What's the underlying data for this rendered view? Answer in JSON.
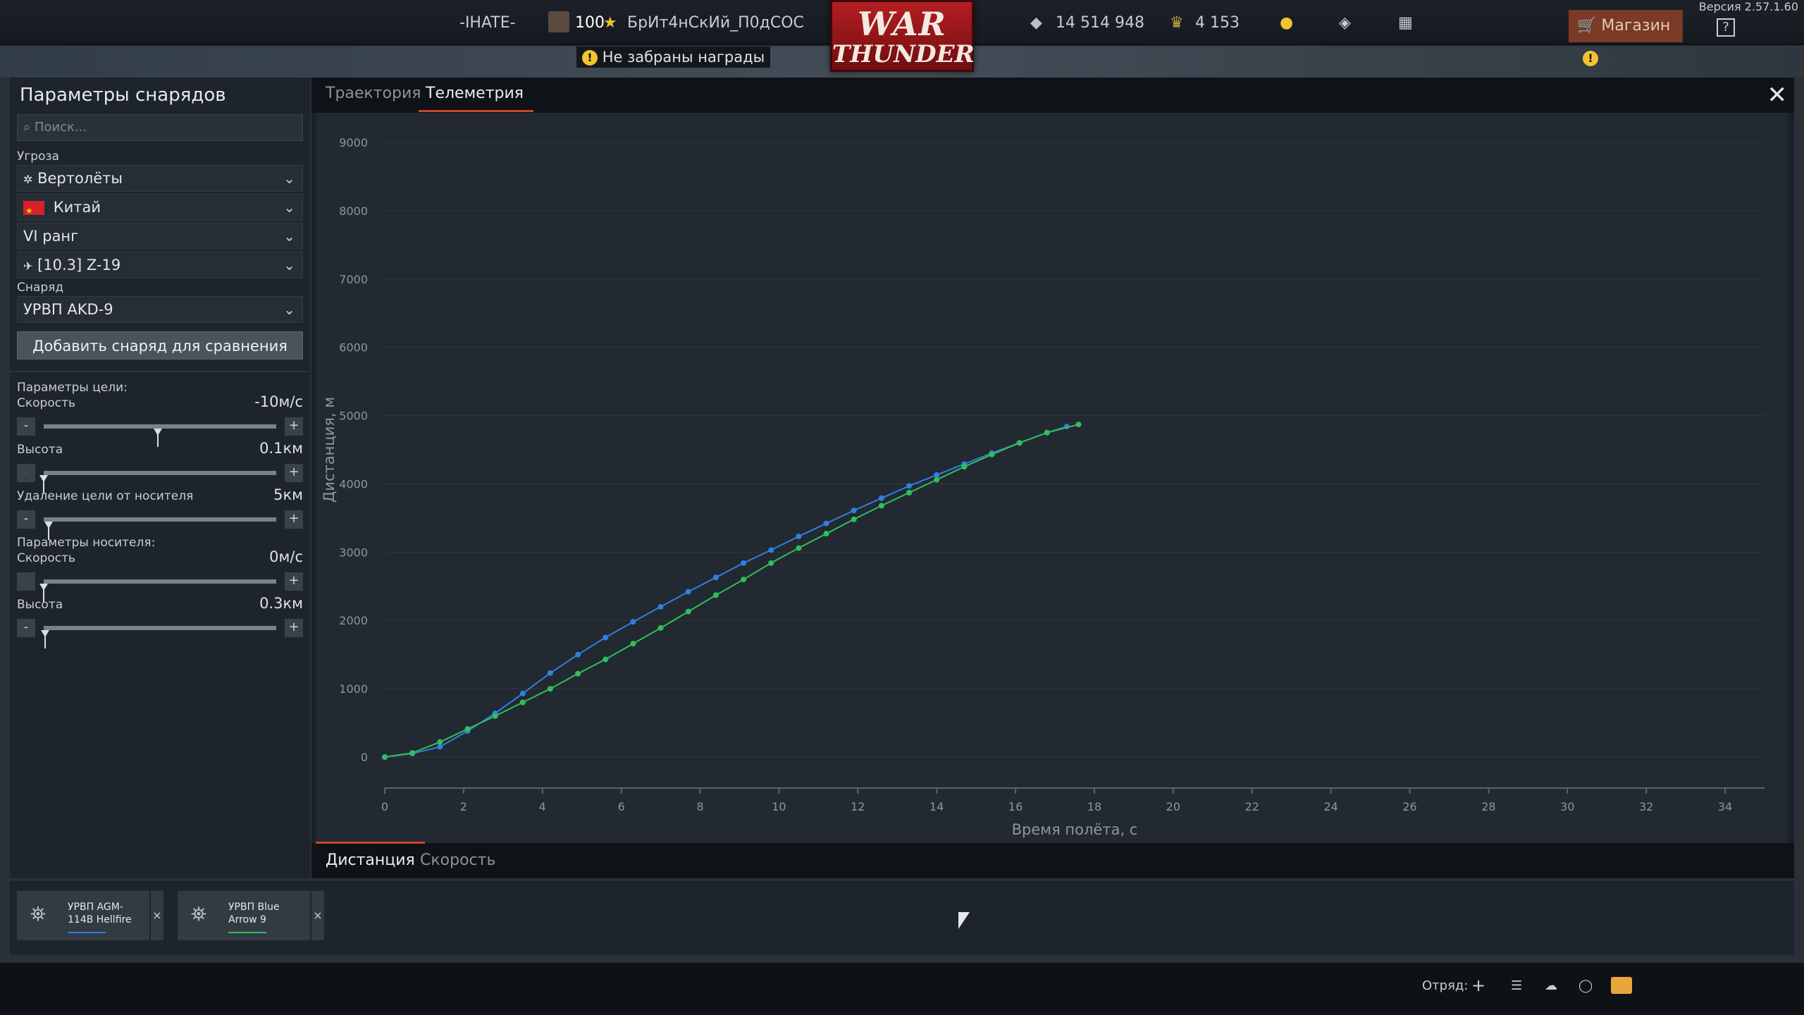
{
  "topbar": {
    "squad_tag": "-IHATE-",
    "level": "100",
    "nickname": "БрИт4нСкИй_П0дСОС",
    "rewards_notice": "Не забраны награды",
    "logo_line1": "WAR",
    "logo_line2": "THUNDER",
    "silver_lions": "14 514 948",
    "golden_eagles": "4 153",
    "shop_label": "Магазин",
    "help_label": "?",
    "version": "Версия 2.57.1.60",
    "icons": [
      "lion-icon",
      "eagle-icon",
      "bulb-icon",
      "diamond-icon",
      "coupon-icon"
    ]
  },
  "left_panel": {
    "title": "Параметры снарядов",
    "search_placeholder": "Поиск...",
    "threat_label": "Угроза",
    "threat_type": "Вертолёты",
    "country": "Китай",
    "rank": "VI ранг",
    "vehicle": "[10.3] Z-19",
    "shell_label": "Снаряд",
    "shell": "УРВП AKD-9",
    "compare_button": "Добавить снаряд для сравнения",
    "target_params_label": "Параметры цели:",
    "target_speed_label": "Скорость",
    "target_speed_value": "-10м/с",
    "target_height_label": "Высота",
    "target_height_value": "0.1км",
    "target_distance_label": "Удаление цели от носителя",
    "target_distance_value": "5км",
    "carrier_params_label": "Параметры носителя:",
    "carrier_speed_label": "Скорость",
    "carrier_speed_value": "0м/с",
    "carrier_height_label": "Высота",
    "carrier_height_value": "0.3км",
    "minus": "-",
    "plus": "+",
    "slider_levels": {
      "target_speed": 0.49,
      "target_height": 0.0,
      "target_distance": 0.02,
      "carrier_speed": 0.0,
      "carrier_height": 0.005
    }
  },
  "main": {
    "tabs": [
      "Траектория",
      "Телеметрия"
    ],
    "active_tab": "Телеметрия",
    "bottom_tabs": [
      "Дистанция",
      "Скорость"
    ],
    "active_bottom_tab": "Дистанция"
  },
  "chart_data": {
    "type": "line",
    "xlabel": "Время полёта, с",
    "ylabel": "Дистанция, м",
    "xlim": [
      0,
      35
    ],
    "ylim": [
      0,
      9000
    ],
    "x_ticks": [
      0,
      2,
      4,
      6,
      8,
      10,
      12,
      14,
      16,
      18,
      20,
      22,
      24,
      26,
      28,
      30,
      32,
      34
    ],
    "y_ticks": [
      0,
      1000,
      2000,
      3000,
      4000,
      5000,
      6000,
      7000,
      8000,
      9000
    ],
    "grid": true,
    "series": [
      {
        "name": "УРВП AGM-114B Hellfire",
        "color": "#2f7fe0",
        "points": [
          [
            0,
            0
          ],
          [
            0.7,
            50
          ],
          [
            1.4,
            150
          ],
          [
            2.1,
            380
          ],
          [
            2.8,
            640
          ],
          [
            3.5,
            930
          ],
          [
            4.2,
            1230
          ],
          [
            4.9,
            1500
          ],
          [
            5.6,
            1750
          ],
          [
            6.3,
            1980
          ],
          [
            7.0,
            2200
          ],
          [
            7.7,
            2420
          ],
          [
            8.4,
            2630
          ],
          [
            9.1,
            2840
          ],
          [
            9.8,
            3030
          ],
          [
            10.5,
            3230
          ],
          [
            11.2,
            3420
          ],
          [
            11.9,
            3610
          ],
          [
            12.6,
            3790
          ],
          [
            13.3,
            3970
          ],
          [
            14.0,
            4130
          ],
          [
            14.7,
            4290
          ],
          [
            15.4,
            4450
          ],
          [
            16.1,
            4600
          ],
          [
            16.8,
            4750
          ],
          [
            17.3,
            4840
          ]
        ]
      },
      {
        "name": "УРВП Blue Arrow 9",
        "color": "#2fbf5a",
        "points": [
          [
            0,
            0
          ],
          [
            0.7,
            60
          ],
          [
            1.4,
            220
          ],
          [
            2.1,
            410
          ],
          [
            2.8,
            600
          ],
          [
            3.5,
            800
          ],
          [
            4.2,
            1000
          ],
          [
            4.9,
            1220
          ],
          [
            5.6,
            1430
          ],
          [
            6.3,
            1660
          ],
          [
            7.0,
            1890
          ],
          [
            7.7,
            2130
          ],
          [
            8.4,
            2370
          ],
          [
            9.1,
            2600
          ],
          [
            9.8,
            2840
          ],
          [
            10.5,
            3060
          ],
          [
            11.2,
            3270
          ],
          [
            11.9,
            3480
          ],
          [
            12.6,
            3680
          ],
          [
            13.3,
            3870
          ],
          [
            14.0,
            4060
          ],
          [
            14.7,
            4250
          ],
          [
            15.4,
            4430
          ],
          [
            16.1,
            4600
          ],
          [
            16.8,
            4750
          ],
          [
            17.6,
            4870
          ]
        ]
      }
    ]
  },
  "compare_strip": {
    "cards": [
      {
        "name": "УРВП AGM-114B Hellfire",
        "color": "#2f7fe0"
      },
      {
        "name": "УРВП Blue Arrow 9",
        "color": "#2fbf5a"
      }
    ],
    "close": "×"
  },
  "footer": {
    "squad_label": "Отряд:"
  }
}
